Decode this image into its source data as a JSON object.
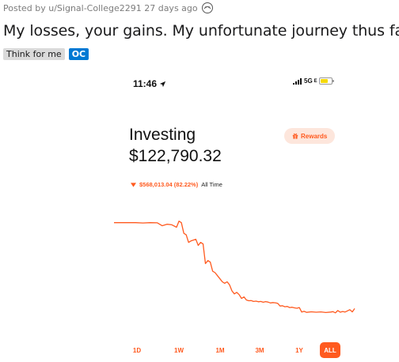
{
  "post": {
    "meta": "Posted by u/Signal-College2291 27 days ago",
    "title": "My losses, your gains. My unfortunate journey thus far.",
    "flairs": [
      "Think for me",
      "OC"
    ]
  },
  "phone": {
    "time": "11:46",
    "network": "5G",
    "network_suffix": "E",
    "account_title": "Investing",
    "account_value": "$122,790.32",
    "rewards_label": "Rewards",
    "change_amount": "$568,013.04 (82.22%)",
    "change_period": "All Time",
    "ranges": [
      "1D",
      "1W",
      "1M",
      "3M",
      "1Y",
      "ALL"
    ],
    "active_range": "ALL",
    "accent_color": "#ff5a1f"
  },
  "chart_data": {
    "type": "line",
    "title": "",
    "xlabel": "",
    "ylabel": "",
    "axes_shown": false,
    "grid": false,
    "series": [
      {
        "x": [
          0,
          3,
          6,
          9,
          12,
          15,
          18,
          20,
          22,
          24,
          26,
          27,
          28,
          29,
          30,
          31,
          32,
          33,
          34,
          35,
          36,
          37,
          38,
          39,
          40,
          41,
          42,
          43,
          44,
          45,
          46,
          47,
          48,
          49,
          50,
          51,
          52,
          53,
          54,
          55,
          56,
          57,
          58,
          59,
          60,
          61,
          62,
          63,
          64,
          65,
          66,
          67,
          68,
          69,
          70,
          71,
          72,
          73,
          74,
          75,
          76,
          77,
          78,
          79,
          80,
          82,
          84,
          86,
          88,
          90,
          91,
          92,
          93,
          94,
          95,
          96,
          97,
          98,
          99,
          100
        ],
        "y": [
          690,
          690,
          690,
          690,
          688,
          690,
          689,
          670,
          680,
          676,
          660,
          700,
          690,
          620,
          610,
          560,
          570,
          575,
          580,
          540,
          560,
          550,
          420,
          440,
          430,
          370,
          360,
          340,
          320,
          300,
          290,
          300,
          280,
          240,
          220,
          230,
          215,
          190,
          200,
          180,
          175,
          176,
          170,
          172,
          168,
          170,
          165,
          169,
          166,
          160,
          163,
          161,
          158,
          140,
          142,
          135,
          137,
          130,
          132,
          128,
          125,
          130,
          100,
          105,
          98,
          102,
          99,
          101,
          97,
          100,
          103,
          95,
          110,
          99,
          104,
          100,
          108,
          116,
          101,
          123
        ]
      }
    ]
  }
}
